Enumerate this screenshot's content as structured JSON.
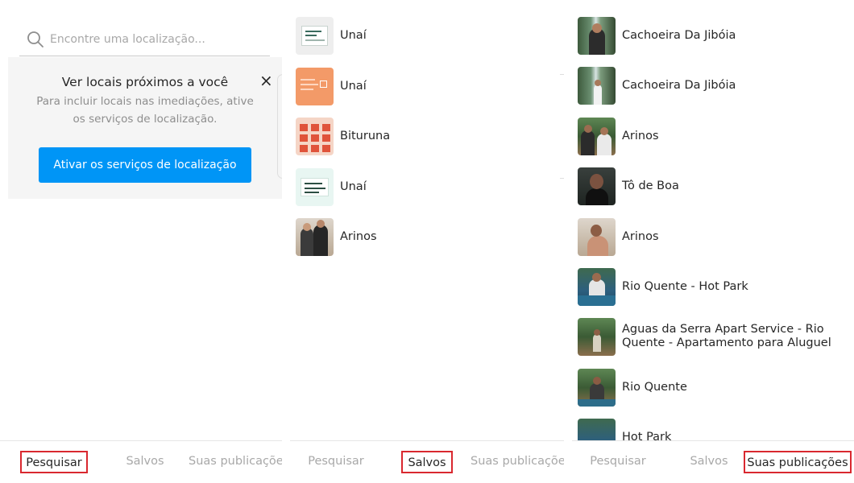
{
  "search": {
    "placeholder": "Encontre uma localização..."
  },
  "location_prompt": {
    "title": "Ver locais próximos a você",
    "description": "Para incluir locais nas imediações, ative os serviços de localização.",
    "button_label": "Ativar os serviços de localização",
    "close_symbol": "×"
  },
  "saved": {
    "items": [
      {
        "label": "Unaí",
        "thumb": "saved-post-thumbnail"
      },
      {
        "label": "Unaí",
        "thumb": "saved-post-thumbnail"
      },
      {
        "label": "Bituruna",
        "thumb": "saved-post-thumbnail"
      },
      {
        "label": "Unaí",
        "thumb": "saved-post-thumbnail"
      },
      {
        "label": "Arinos",
        "thumb": "photo-thumbnail"
      }
    ]
  },
  "your_posts": {
    "items": [
      {
        "label": "Cachoeira Da Jibóia"
      },
      {
        "label": "Cachoeira Da Jibóia"
      },
      {
        "label": "Arinos"
      },
      {
        "label": "Tô de Boa"
      },
      {
        "label": "Arinos"
      },
      {
        "label": "Rio Quente - Hot Park"
      },
      {
        "label_line1": "Aguas da Serra Apart Service - Rio",
        "label_line2": "Quente - Apartamento para Aluguel"
      },
      {
        "label": "Rio Quente"
      },
      {
        "label": "Hot Park"
      }
    ]
  },
  "tabs": {
    "search": "Pesquisar",
    "saved": "Salvos",
    "your_posts": "Suas publicações"
  },
  "panels": [
    {
      "active_tab": "search"
    },
    {
      "active_tab": "saved"
    },
    {
      "active_tab": "your_posts"
    }
  ],
  "colors": {
    "accent_blue": "#0095f6",
    "highlight_red": "#d9282f",
    "text_primary": "#262626",
    "text_muted": "#a8a8a8"
  }
}
